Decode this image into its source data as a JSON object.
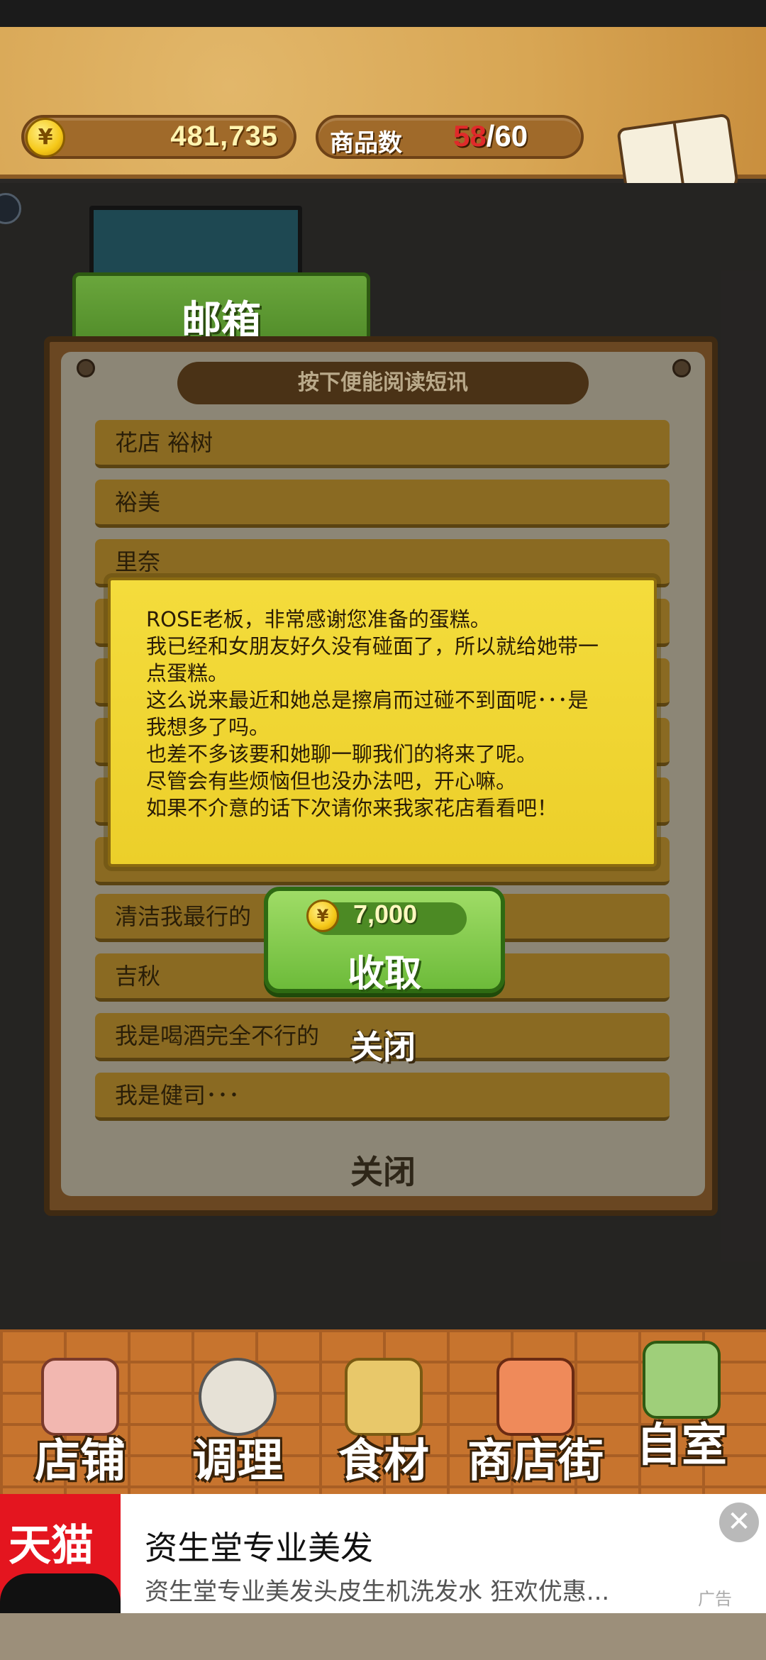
{
  "header": {
    "coins": "481,735",
    "goods_label": "商品数",
    "goods_current": "58",
    "goods_separator": "/",
    "goods_max": "60",
    "recipe_label": "食谱"
  },
  "mailbox": {
    "tab_label": "邮箱",
    "hint": "按下便能阅读短讯",
    "items": [
      "花店 裕树",
      "裕美",
      "里奈",
      "",
      "",
      "",
      "",
      "",
      "清洁我最行的",
      "吉秋",
      "我是喝酒完全不行的",
      "我是健司･･･"
    ],
    "close_label": "关闭"
  },
  "message_dialog": {
    "lines": [
      "ROSE老板，非常感谢您准备的蛋糕。",
      "我已经和女朋友好久没有碰面了，所以就给她带一",
      "点蛋糕。",
      "这么说来最近和她总是擦肩而过碰不到面呢･･･是",
      "我想多了吗。",
      "也差不多该要和她聊一聊我们的将来了呢。",
      "尽管会有些烦恼但也没办法吧，开心嘛。",
      "如果不介意的话下次请你来我家花店看看吧！"
    ],
    "reward_amount": "7,000",
    "collect_label": "收取",
    "close_label": "关闭"
  },
  "bottom_nav": [
    {
      "label": "店铺",
      "icon": "cake-icon"
    },
    {
      "label": "调理",
      "icon": "mixing-bowl-icon"
    },
    {
      "label": "食材",
      "icon": "flour-sack-icon"
    },
    {
      "label": "商店街",
      "icon": "shop-icon"
    },
    {
      "label": "自室",
      "icon": "staff-only-sign-icon"
    }
  ],
  "ad": {
    "brand": "天猫",
    "title": "资生堂专业美发",
    "description": "资生堂专业美发头皮生机洗发水 狂欢优惠...",
    "tag": "广告",
    "close_symbol": "✕"
  },
  "colors": {
    "coin": "#f5c818",
    "mail_tab": "#5a962e",
    "note": "#f0d634",
    "collect_button": "#7fc94a",
    "ad_brand": "#e4151f"
  }
}
